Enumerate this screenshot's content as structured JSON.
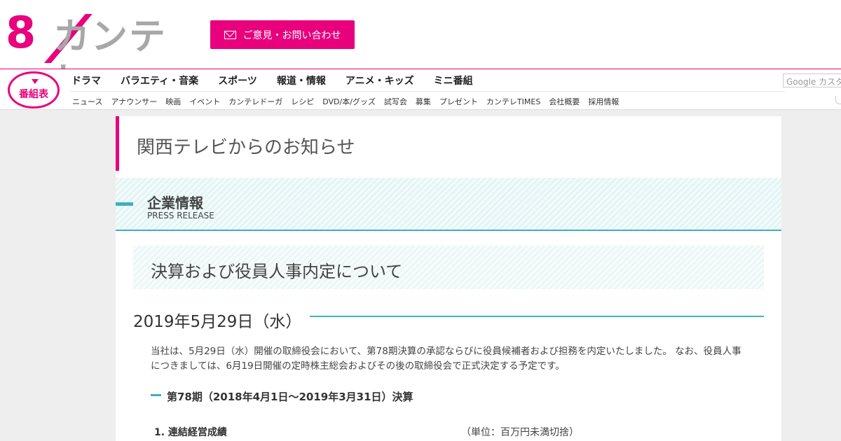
{
  "header": {
    "logo_number": "8",
    "logo_text": "カンテレ",
    "contact_button": "ご意見・お問い合わせ"
  },
  "nav": {
    "program_button": "番組表",
    "main": [
      "ドラマ",
      "バラエティ・音楽",
      "スポーツ",
      "報道・情報",
      "アニメ・キッズ",
      "ミニ番組"
    ],
    "sub": [
      "ニュース",
      "アナウンサー",
      "映画",
      "イベント",
      "カンテレドーガ",
      "レシピ",
      "DVD/本/グッズ",
      "試写会",
      "募集",
      "プレゼント",
      "カンテレTIMES",
      "会社概要",
      "採用情報"
    ],
    "search_placeholder": "Google カスタム検索"
  },
  "page": {
    "notice_title": "関西テレビからのお知らせ",
    "section_title": "企業情報",
    "section_subtitle": "PRESS RELEASE",
    "article_title": "決算および役員人事内定について",
    "date": "2019年5月29日（水）",
    "body": "当社は、5月29日（水）開催の取締役会において、第78期決算の承認ならびに役員候補者および担務を内定いたしました。 なお、役員人事につきましては、6月19日開催の定時株主総会およびその後の取締役会で正式決定する予定です。",
    "sub_heading": "第78期（2018年4月1日～2019年3月31日）決算",
    "list_label": "1. 連結経営成績",
    "unit_note": "（単位：百万円未満切捨）"
  },
  "colors": {
    "accent": "#e8007d",
    "teal": "#3db2bd",
    "logo_gray": "#a8a8a8"
  }
}
